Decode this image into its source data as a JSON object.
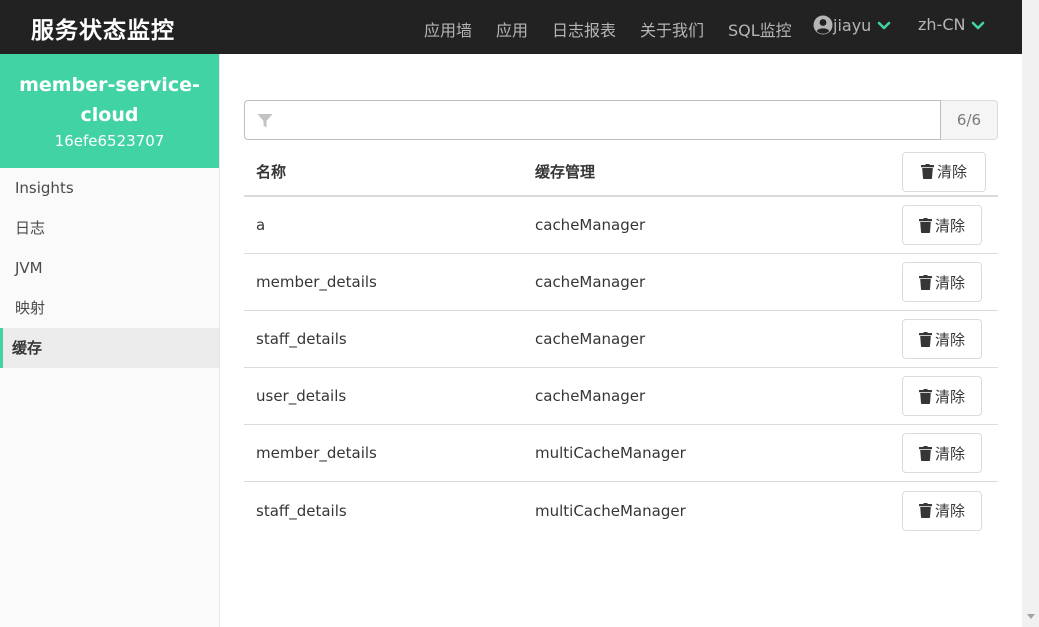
{
  "navbar": {
    "brand": "服务状态监控",
    "items": [
      "应用墙",
      "应用",
      "日志报表",
      "关于我们",
      "SQL监控"
    ],
    "user": "jiayu",
    "lang": "zh-CN"
  },
  "sidebar": {
    "app_name_line1": "member-service-",
    "app_name_line2": "cloud",
    "app_id": "16efe6523707",
    "items": [
      "Insights",
      "日志",
      "JVM",
      "映射",
      "缓存"
    ]
  },
  "filter": {
    "placeholder": "",
    "count": "6/6"
  },
  "table": {
    "headers": {
      "name": "名称",
      "manager": "缓存管理",
      "clear_all": "清除"
    },
    "clear_label": "清除",
    "rows": [
      {
        "name": "a",
        "manager": "cacheManager"
      },
      {
        "name": "member_details",
        "manager": "cacheManager"
      },
      {
        "name": "staff_details",
        "manager": "cacheManager"
      },
      {
        "name": "user_details",
        "manager": "cacheManager"
      },
      {
        "name": "member_details",
        "manager": "multiCacheManager"
      },
      {
        "name": "staff_details",
        "manager": "multiCacheManager"
      }
    ]
  },
  "colors": {
    "navbar": "#222222",
    "accent": "#42d3a5"
  }
}
